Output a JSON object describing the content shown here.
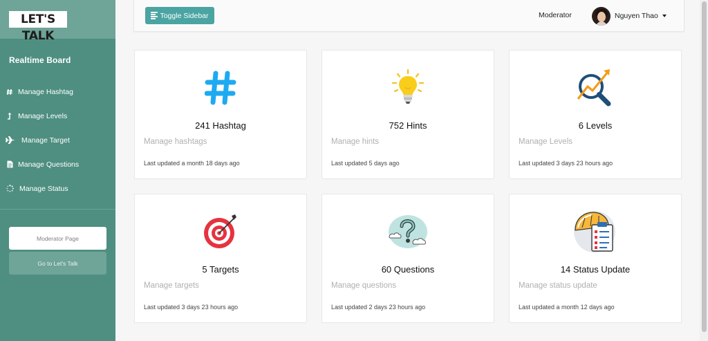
{
  "app": {
    "logo": "LET'S TALK",
    "board_title": "Realtime Board"
  },
  "sidebar": {
    "items": [
      {
        "label": "Manage Hashtag",
        "icon": "hash-icon"
      },
      {
        "label": "Manage Levels",
        "icon": "level-up-icon"
      },
      {
        "label": "Manage Target",
        "icon": "plane-icon"
      },
      {
        "label": "Manage Questions",
        "icon": "document-icon"
      },
      {
        "label": "Manage Status",
        "icon": "spinner-icon"
      }
    ],
    "moderator_button": "Moderator Page",
    "go_button": "Go to Let's Talk"
  },
  "topbar": {
    "toggle_label": "Toggle Sidebar",
    "role": "Moderator",
    "user_name": "Nguyen Thao"
  },
  "cards": [
    {
      "title": "241 Hashtag",
      "subtitle": "Manage hashtags",
      "updated": "Last updated a month 18 days ago",
      "icon": "hashtag-icon"
    },
    {
      "title": "752 Hints",
      "subtitle": "Manage hints",
      "updated": "Last updated 5 days ago",
      "icon": "lightbulb-icon"
    },
    {
      "title": "6 Levels",
      "subtitle": "Manage Levels",
      "updated": "Last updated 3 days 23 hours ago",
      "icon": "chart-magnifier-icon"
    },
    {
      "title": "5 Targets",
      "subtitle": "Manage targets",
      "updated": "Last updated 3 days 23 hours ago",
      "icon": "target-icon"
    },
    {
      "title": "60 Questions",
      "subtitle": "Manage questions",
      "updated": "Last updated 2 days 23 hours ago",
      "icon": "question-cloud-icon"
    },
    {
      "title": "14 Status Update",
      "subtitle": "Manage status update",
      "updated": "Last updated a month 12 days ago",
      "icon": "status-clipboard-icon"
    }
  ],
  "colors": {
    "sidebar": "#4e8f81",
    "sidebar_light": "#6fa498",
    "accent": "#4aa4a2",
    "card_border": "#e6e6e6"
  }
}
